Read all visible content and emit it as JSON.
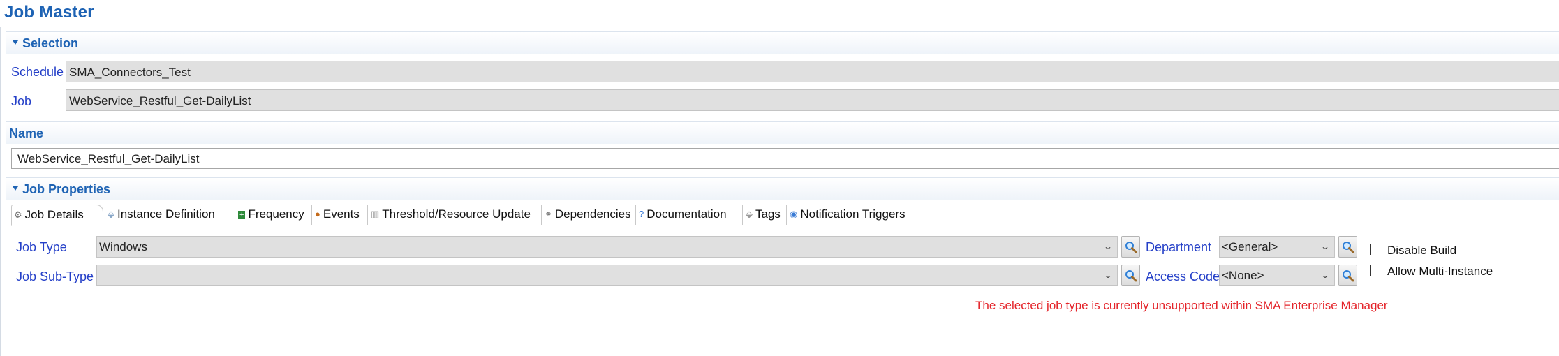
{
  "page": {
    "title": "Job Master"
  },
  "sections": {
    "selection": "Selection",
    "name": "Name",
    "job_properties": "Job Properties"
  },
  "selection": {
    "schedule_label": "Schedule",
    "schedule_value": "SMA_Connectors_Test",
    "job_label": "Job",
    "job_value": "WebService_Restful_Get-DailyList"
  },
  "name": {
    "value": "WebService_Restful_Get-DailyList"
  },
  "tabs": [
    {
      "label": "Job Details",
      "icon": "gear-icon",
      "active": true
    },
    {
      "label": "Instance Definition",
      "icon": "tag-icon"
    },
    {
      "label": "Frequency",
      "icon": "calendar-plus-icon"
    },
    {
      "label": "Events",
      "icon": "event-icon"
    },
    {
      "label": "Threshold/Resource Update",
      "icon": "chart-icon"
    },
    {
      "label": "Dependencies",
      "icon": "link-icon"
    },
    {
      "label": "Documentation",
      "icon": "help-icon"
    },
    {
      "label": "Tags",
      "icon": "tag-icon"
    },
    {
      "label": "Notification Triggers",
      "icon": "broadcast-icon"
    }
  ],
  "job_details": {
    "job_type_label": "Job Type",
    "job_type_value": "Windows",
    "job_subtype_label": "Job Sub-Type",
    "job_subtype_value": "",
    "department_label": "Department",
    "department_value": "<General>",
    "access_code_label": "Access Code",
    "access_code_value": "<None>",
    "disable_build_label": "Disable Build",
    "allow_multi_label": "Allow Multi-Instance",
    "warning": "The selected job type is currently unsupported within SMA Enterprise Manager"
  },
  "colors": {
    "accent": "#1e63b4",
    "label": "#2540c8",
    "warning": "#e4242a"
  }
}
